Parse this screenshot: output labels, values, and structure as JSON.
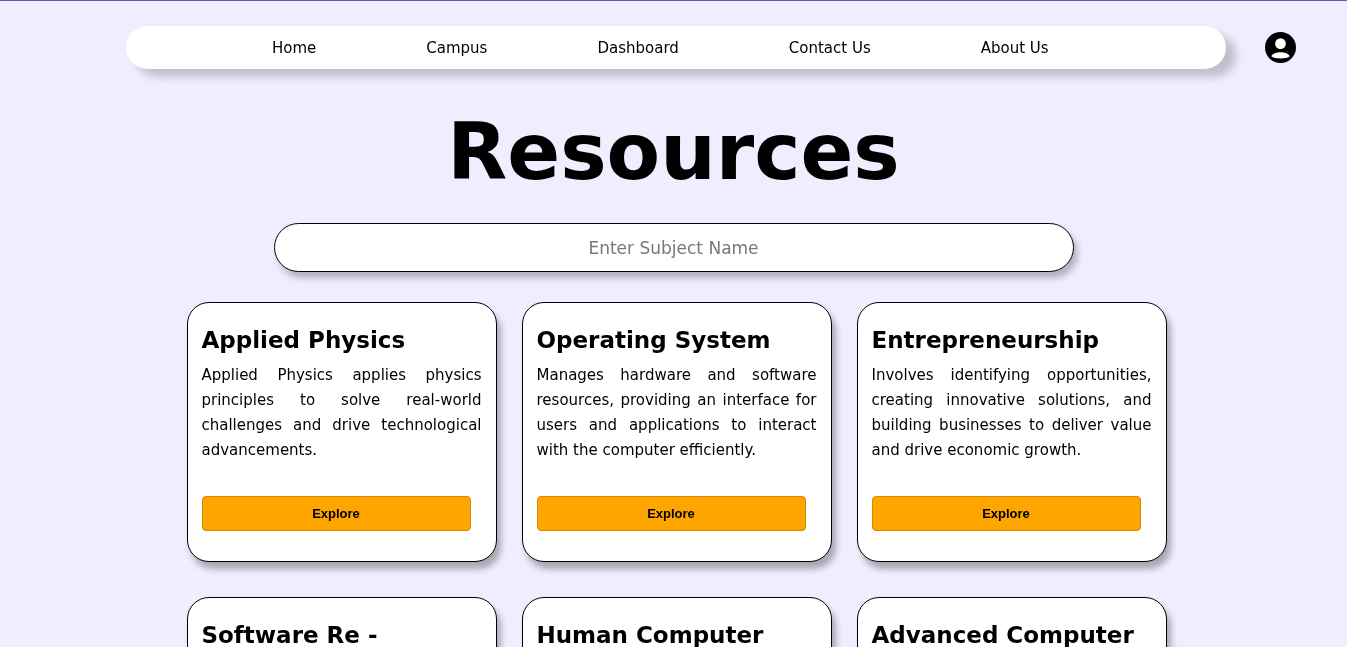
{
  "nav": {
    "links": [
      "Home",
      "Campus",
      "Dashboard",
      "Contact Us",
      "About Us"
    ]
  },
  "title": "Resources",
  "search": {
    "placeholder": "Enter Subject Name"
  },
  "cards": [
    {
      "title": "Applied Physics",
      "description": "Applied Physics applies physics principles to solve real-world challenges and drive technological advancements.",
      "button": "Explore"
    },
    {
      "title": "Operating System",
      "description": "Manages hardware and software resources, providing an interface for users and applications to interact with the computer efficiently.",
      "button": "Explore"
    },
    {
      "title": "Entrepreneurship",
      "description": "Involves identifying opportunities, creating innovative solutions, and building businesses to deliver value and drive economic growth.",
      "button": "Explore"
    },
    {
      "title": "Software Re -"
    },
    {
      "title": "Human Computer"
    },
    {
      "title": "Advanced Computer"
    }
  ]
}
